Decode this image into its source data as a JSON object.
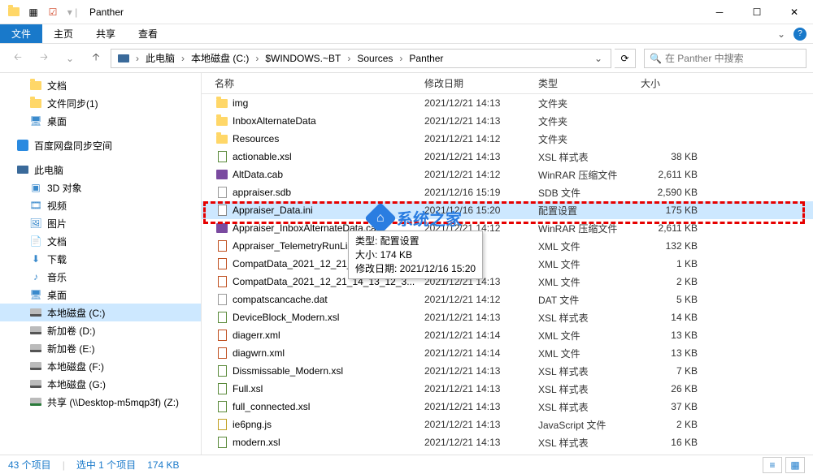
{
  "window": {
    "title": "Panther"
  },
  "ribbon": {
    "file": "文件",
    "tabs": [
      "主页",
      "共享",
      "查看"
    ]
  },
  "breadcrumb": {
    "items": [
      "此电脑",
      "本地磁盘 (C:)",
      "$WINDOWS.~BT",
      "Sources",
      "Panther"
    ]
  },
  "search": {
    "placeholder": "在 Panther 中搜索"
  },
  "sidebar": {
    "group1": [
      {
        "icon": "folder",
        "label": "文档"
      },
      {
        "icon": "folder",
        "label": "文件同步(1)"
      },
      {
        "icon": "desktop",
        "label": "桌面"
      }
    ],
    "group2": [
      {
        "icon": "baidu",
        "label": "百度网盘同步空间"
      }
    ],
    "group3_header": {
      "icon": "pc",
      "label": "此电脑"
    },
    "group3": [
      {
        "icon": "3d",
        "label": "3D 对象"
      },
      {
        "icon": "video",
        "label": "视频"
      },
      {
        "icon": "pic",
        "label": "图片"
      },
      {
        "icon": "doc",
        "label": "文档"
      },
      {
        "icon": "download",
        "label": "下载"
      },
      {
        "icon": "music",
        "label": "音乐"
      },
      {
        "icon": "desktop",
        "label": "桌面"
      },
      {
        "icon": "disk",
        "label": "本地磁盘 (C:)",
        "selected": true
      },
      {
        "icon": "disk",
        "label": "新加卷 (D:)"
      },
      {
        "icon": "disk",
        "label": "新加卷 (E:)"
      },
      {
        "icon": "disk",
        "label": "本地磁盘 (F:)"
      },
      {
        "icon": "disk",
        "label": "本地磁盘 (G:)"
      },
      {
        "icon": "net",
        "label": "共享 (\\\\Desktop-m5mqp3f) (Z:)"
      }
    ]
  },
  "columns": {
    "name": "名称",
    "date": "修改日期",
    "type": "类型",
    "size": "大小"
  },
  "files": [
    {
      "icon": "folder",
      "name": "img",
      "date": "2021/12/21 14:13",
      "type": "文件夹",
      "size": ""
    },
    {
      "icon": "folder",
      "name": "InboxAlternateData",
      "date": "2021/12/21 14:13",
      "type": "文件夹",
      "size": ""
    },
    {
      "icon": "folder",
      "name": "Resources",
      "date": "2021/12/21 14:12",
      "type": "文件夹",
      "size": ""
    },
    {
      "icon": "xsl",
      "name": "actionable.xsl",
      "date": "2021/12/21 14:13",
      "type": "XSL 样式表",
      "size": "38 KB"
    },
    {
      "icon": "cab",
      "name": "AltData.cab",
      "date": "2021/12/21 14:12",
      "type": "WinRAR 压缩文件",
      "size": "2,611 KB"
    },
    {
      "icon": "sdb",
      "name": "appraiser.sdb",
      "date": "2021/12/16 15:19",
      "type": "SDB 文件",
      "size": "2,590 KB"
    },
    {
      "icon": "ini",
      "name": "Appraiser_Data.ini",
      "date": "2021/12/16 15:20",
      "type": "配置设置",
      "size": "175 KB",
      "highlighted": true
    },
    {
      "icon": "cab",
      "name": "Appraiser_InboxAlternateData.cab",
      "date": "2021/12/21 14:12",
      "type": "WinRAR 压缩文件",
      "size": "2,611 KB"
    },
    {
      "icon": "xml",
      "name": "Appraiser_TelemetryRunList.xml",
      "date": "",
      "type": "XML 文件",
      "size": "132 KB"
    },
    {
      "icon": "xml",
      "name": "CompatData_2021_12_21_14_13_08...",
      "date": "",
      "type": "XML 文件",
      "size": "1 KB"
    },
    {
      "icon": "xml",
      "name": "CompatData_2021_12_21_14_13_12_3...",
      "date": "2021/12/21 14:13",
      "type": "XML 文件",
      "size": "2 KB"
    },
    {
      "icon": "dat",
      "name": "compatscancache.dat",
      "date": "2021/12/21 14:12",
      "type": "DAT 文件",
      "size": "5 KB"
    },
    {
      "icon": "xsl",
      "name": "DeviceBlock_Modern.xsl",
      "date": "2021/12/21 14:13",
      "type": "XSL 样式表",
      "size": "14 KB"
    },
    {
      "icon": "xml",
      "name": "diagerr.xml",
      "date": "2021/12/21 14:14",
      "type": "XML 文件",
      "size": "13 KB"
    },
    {
      "icon": "xml",
      "name": "diagwrn.xml",
      "date": "2021/12/21 14:14",
      "type": "XML 文件",
      "size": "13 KB"
    },
    {
      "icon": "xsl",
      "name": "Dissmissable_Modern.xsl",
      "date": "2021/12/21 14:13",
      "type": "XSL 样式表",
      "size": "7 KB"
    },
    {
      "icon": "xsl",
      "name": "Full.xsl",
      "date": "2021/12/21 14:13",
      "type": "XSL 样式表",
      "size": "26 KB"
    },
    {
      "icon": "xsl",
      "name": "full_connected.xsl",
      "date": "2021/12/21 14:13",
      "type": "XSL 样式表",
      "size": "37 KB"
    },
    {
      "icon": "js",
      "name": "ie6png.js",
      "date": "2021/12/21 14:13",
      "type": "JavaScript 文件",
      "size": "2 KB"
    },
    {
      "icon": "xsl",
      "name": "modern.xsl",
      "date": "2021/12/21 14:13",
      "type": "XSL 样式表",
      "size": "16 KB"
    }
  ],
  "tooltip": {
    "line1": "类型: 配置设置",
    "line2": "大小: 174 KB",
    "line3": "修改日期: 2021/12/16 15:20"
  },
  "watermark": "系统之家",
  "statusbar": {
    "items": "43 个项目",
    "selected": "选中 1 个项目",
    "size": "174 KB"
  }
}
